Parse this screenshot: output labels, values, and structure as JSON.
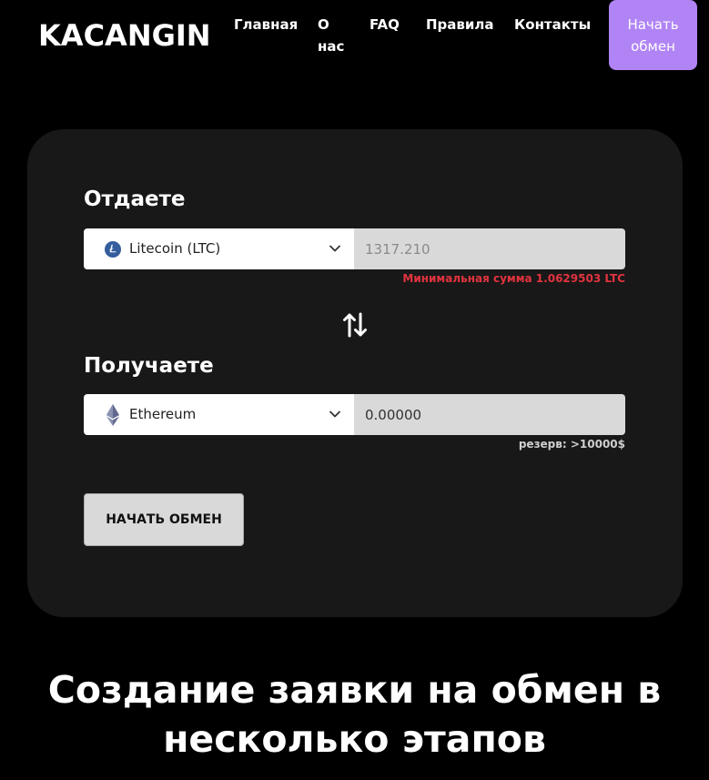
{
  "header": {
    "logo": "KACANGIN",
    "nav": {
      "home": "Главная",
      "about": "О нас",
      "faq": "FAQ",
      "rules": "Правила",
      "contacts": "Контакты"
    },
    "cta_label": "Начать обмен"
  },
  "exchange": {
    "give": {
      "label": "Отдаете",
      "currency": "Litecoin (LTC)",
      "currency_icon": "litecoin-icon",
      "amount": "1317.210",
      "min_note": "Минимальная сумма 1.0629503 LTC"
    },
    "get": {
      "label": "Получаете",
      "currency": "Ethereum",
      "currency_icon": "ethereum-icon",
      "amount": "0.00000",
      "reserve_note": "резерв: >10000$"
    },
    "start_label": "НАЧАТЬ ОБМЕН"
  },
  "headline": "Создание заявки на обмен в несколько этапов",
  "colors": {
    "accent": "#b184f5",
    "error": "#e2333f",
    "card": "#181818",
    "background": "#000000"
  }
}
